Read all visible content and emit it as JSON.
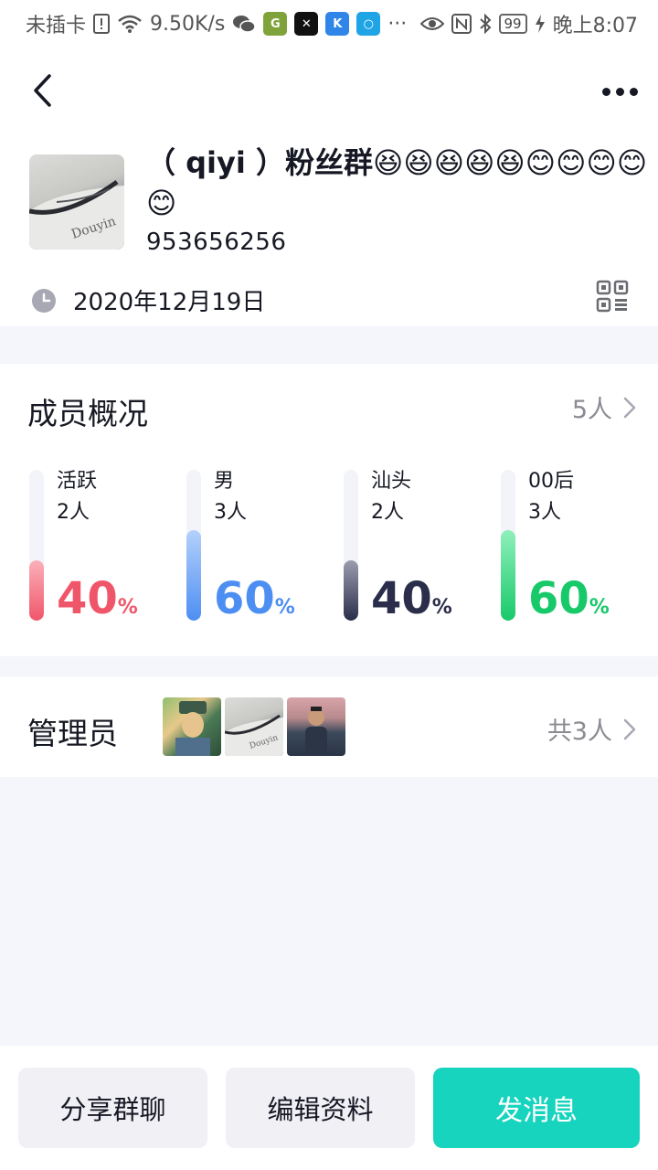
{
  "status_bar": {
    "carrier": "未插卡",
    "speed": "9.50K/s",
    "battery": "99",
    "time": "晚上8:07"
  },
  "header": {
    "back_icon": "chevron-left-icon",
    "more_icon": "more-dots-icon"
  },
  "group": {
    "name": "（ qiyi ）粉丝群😆😆😆😆😆😊😊😊😊😊",
    "id": "953656256",
    "created_date": "2020年12月19日",
    "qr_icon": "qr-code-icon"
  },
  "members": {
    "title": "成员概况",
    "count": "5人",
    "stats": [
      {
        "label": "活跃",
        "count": "2人",
        "percent": "40",
        "sign": "%",
        "fill_fraction": 0.4,
        "color": "#f0566a",
        "gradient_top": "#fbb0b9"
      },
      {
        "label": "男",
        "count": "3人",
        "percent": "60",
        "sign": "%",
        "fill_fraction": 0.6,
        "color": "#4d8ef3",
        "gradient_top": "#b5d1fb"
      },
      {
        "label": "汕头",
        "count": "2人",
        "percent": "40",
        "sign": "%",
        "fill_fraction": 0.4,
        "color": "#2b2e4a",
        "gradient_top": "#9a9dae"
      },
      {
        "label": "00后",
        "count": "3人",
        "percent": "60",
        "sign": "%",
        "fill_fraction": 0.6,
        "color": "#18c96a",
        "gradient_top": "#8ff0bb"
      }
    ]
  },
  "admins": {
    "title": "管理员",
    "count": "共3人"
  },
  "actions": {
    "share": "分享群聊",
    "edit": "编辑资料",
    "send": "发消息"
  },
  "colors": {
    "accent": "#17d4be",
    "background": "#f5f6fb"
  }
}
